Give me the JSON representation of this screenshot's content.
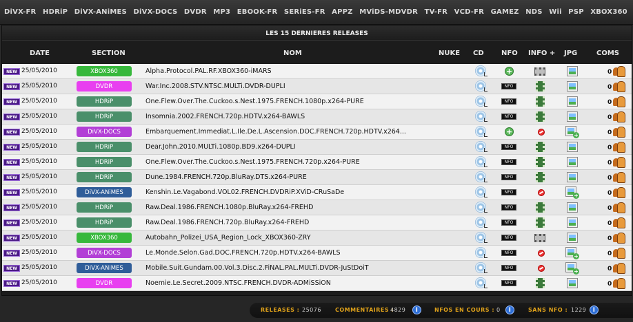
{
  "nav": [
    "DiVX-FR",
    "HDRiP",
    "DiVX-ANiMES",
    "DiVX-DOCS",
    "DVDR",
    "MP3",
    "EBOOK-FR",
    "SERiES-FR",
    "APPZ",
    "MViDS-MDVDR",
    "TV-FR",
    "VCD-FR",
    "GAMEZ",
    "NDS",
    "Wii",
    "PSP",
    "XBOX360"
  ],
  "panel": {
    "title": "LES 15 DERNIERES RELEASES"
  },
  "columns": {
    "date": "DATE",
    "section": "SECTION",
    "nom": "NOM",
    "nuke": "NUKE",
    "cd": "CD",
    "nfo": "NFO",
    "info_plus": "INFO +",
    "jpg": "JPG",
    "coms": "COMS"
  },
  "section_colors": {
    "XBOX360": "#37b83c",
    "DVDR": "#e83ff0",
    "HDRiP": "#4a8f6a",
    "DiVX-DOCS": "#b23fd6",
    "DiVX-ANiMES": "#2f5d99"
  },
  "new_label": "NEW",
  "releases": [
    {
      "date": "25/05/2010",
      "section": "XBOX360",
      "name": "Alpha.Protocol.PAL.RF.XBOX360-iMARS",
      "nfo": "add",
      "info": "grey",
      "jpg": "plain",
      "coms": "0"
    },
    {
      "date": "25/05/2010",
      "section": "DVDR",
      "name": "War.Inc.2008.STV.NTSC.MULTi.DVDR-DUPLI",
      "nfo": "nfo",
      "info": "film",
      "jpg": "plain",
      "coms": "0"
    },
    {
      "date": "25/05/2010",
      "section": "HDRiP",
      "name": "One.Flew.Over.The.Cuckoo.s.Nest.1975.FRENCH.1080p.x264-PURE",
      "nfo": "nfo",
      "info": "film",
      "jpg": "plain",
      "coms": "0"
    },
    {
      "date": "25/05/2010",
      "section": "HDRiP",
      "name": "Insomnia.2002.FRENCH.720p.HDTV.x264-BAWLS",
      "nfo": "nfo",
      "info": "film",
      "jpg": "plain",
      "coms": "0"
    },
    {
      "date": "25/05/2010",
      "section": "DiVX-DOCS",
      "name": "Embarquement.Immediat.L.Ile.De.L.Ascension.DOC.FRENCH.720p.HDTV.x264...",
      "nfo": "add",
      "info": "none",
      "jpg": "add",
      "coms": "0"
    },
    {
      "date": "25/05/2010",
      "section": "HDRiP",
      "name": "Dear.John.2010.MULTi.1080p.BD9.x264-DUPLI",
      "nfo": "nfo",
      "info": "film",
      "jpg": "plain",
      "coms": "0"
    },
    {
      "date": "25/05/2010",
      "section": "HDRiP",
      "name": "One.Flew.Over.The.Cuckoo.s.Nest.1975.FRENCH.720p.x264-PURE",
      "nfo": "nfo",
      "info": "film",
      "jpg": "plain",
      "coms": "0"
    },
    {
      "date": "25/05/2010",
      "section": "HDRiP",
      "name": "Dune.1984.FRENCH.720p.BluRay.DTS.x264-PURE",
      "nfo": "nfo",
      "info": "film",
      "jpg": "plain",
      "coms": "0"
    },
    {
      "date": "25/05/2010",
      "section": "DiVX-ANiMES",
      "name": "Kenshin.Le.Vagabond.VOL02.FRENCH.DVDRiP.XViD-CRuSaDe",
      "nfo": "nfo",
      "info": "none",
      "jpg": "add",
      "coms": "0"
    },
    {
      "date": "25/05/2010",
      "section": "HDRiP",
      "name": "Raw.Deal.1986.FRENCH.1080p.BluRay.x264-FREHD",
      "nfo": "nfo",
      "info": "film",
      "jpg": "plain",
      "coms": "0"
    },
    {
      "date": "25/05/2010",
      "section": "HDRiP",
      "name": "Raw.Deal.1986.FRENCH.720p.BluRay.x264-FREHD",
      "nfo": "nfo",
      "info": "film",
      "jpg": "plain",
      "coms": "0"
    },
    {
      "date": "25/05/2010",
      "section": "XBOX360",
      "name": "Autobahn_Polizei_USA_Region_Lock_XBOX360-ZRY",
      "nfo": "nfo",
      "info": "grey",
      "jpg": "plain",
      "coms": "0"
    },
    {
      "date": "25/05/2010",
      "section": "DiVX-DOCS",
      "name": "Le.Monde.Selon.Gad.DOC.FRENCH.720p.HDTV.x264-BAWLS",
      "nfo": "nfo",
      "info": "none",
      "jpg": "add",
      "coms": "0"
    },
    {
      "date": "25/05/2010",
      "section": "DiVX-ANiMES",
      "name": "Mobile.Suit.Gundam.00.Vol.3.Disc.2.FiNAL.PAL.MULTi.DVDR-JuStDoiT",
      "nfo": "nfo",
      "info": "none",
      "jpg": "add",
      "coms": "0"
    },
    {
      "date": "25/05/2010",
      "section": "DVDR",
      "name": "Noemie.Le.Secret.2009.NTSC.FRENCH.DVDR-ADMiSSiON",
      "nfo": "nfo",
      "info": "film",
      "jpg": "plain",
      "coms": "0"
    }
  ],
  "nfo_badge": "NFO",
  "footer": {
    "releases_label": "RELEASES :",
    "releases_value": "25076",
    "comments_label": "COMMENTAIRES :",
    "comments_value": "4829",
    "nfos_label": "NFOS EN COURS :",
    "nfos_value": "0",
    "sans_nfo_label": "SANS NFO :",
    "sans_nfo_value": "1229"
  }
}
